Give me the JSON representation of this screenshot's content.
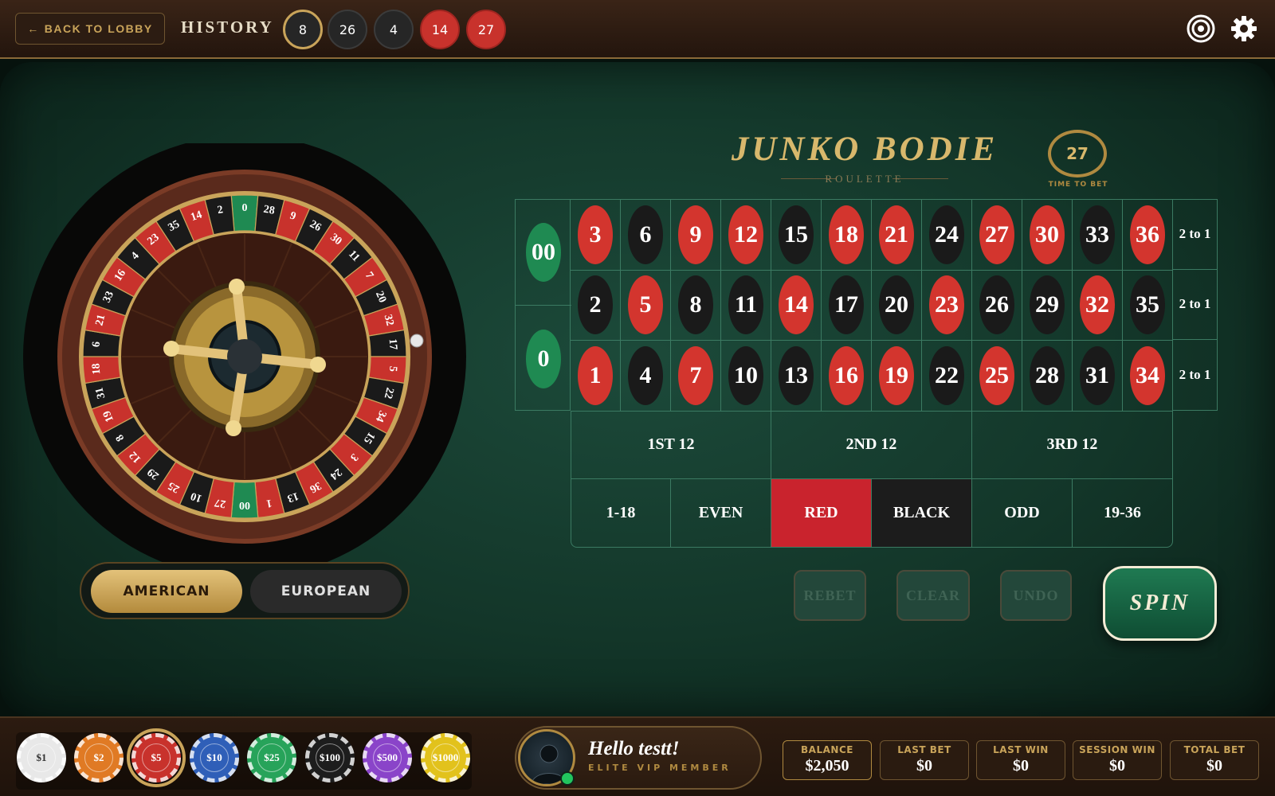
{
  "header": {
    "back_label": "BACK TO LOBBY",
    "history_label": "HISTORY",
    "history": [
      {
        "num": "8",
        "color": "black"
      },
      {
        "num": "26",
        "color": "black"
      },
      {
        "num": "4",
        "color": "black"
      },
      {
        "num": "14",
        "color": "red"
      },
      {
        "num": "27",
        "color": "red"
      }
    ],
    "icons": [
      "target-icon",
      "gear-icon"
    ]
  },
  "game": {
    "title": "JUNKO BODIE",
    "subtitle": "ROULETTE",
    "timer_value": "27",
    "timer_label": "TIME TO BET"
  },
  "wheel": {
    "numbers": [
      "0",
      "28",
      "9",
      "26",
      "30",
      "11",
      "7",
      "20",
      "32",
      "17",
      "5",
      "22",
      "34",
      "15",
      "3",
      "24",
      "36",
      "13",
      "1",
      "00",
      "27",
      "10",
      "25",
      "29",
      "12",
      "8",
      "19",
      "31",
      "18",
      "6",
      "21",
      "33",
      "16",
      "4",
      "23",
      "35",
      "14",
      "2"
    ],
    "red_numbers": [
      "1",
      "3",
      "5",
      "7",
      "9",
      "12",
      "14",
      "16",
      "18",
      "19",
      "21",
      "23",
      "25",
      "27",
      "30",
      "32",
      "34",
      "36"
    ]
  },
  "variant_toggle": {
    "american_label": "AMERICAN",
    "european_label": "EUROPEAN",
    "selected": "AMERICAN"
  },
  "board": {
    "zeros": [
      "00",
      "0"
    ],
    "rows": [
      [
        "3",
        "6",
        "9",
        "12",
        "15",
        "18",
        "21",
        "24",
        "27",
        "30",
        "33",
        "36"
      ],
      [
        "2",
        "5",
        "8",
        "11",
        "14",
        "17",
        "20",
        "23",
        "26",
        "29",
        "32",
        "35"
      ],
      [
        "1",
        "4",
        "7",
        "10",
        "13",
        "16",
        "19",
        "22",
        "25",
        "28",
        "31",
        "34"
      ]
    ],
    "column_bets": [
      "2 to 1",
      "2 to 1",
      "2 to 1"
    ],
    "dozens": [
      "1ST 12",
      "2ND 12",
      "3RD 12"
    ],
    "even_money": [
      "1-18",
      "EVEN",
      "RED",
      "BLACK",
      "ODD",
      "19-36"
    ],
    "colors": {
      "red": "#d3352e",
      "black": "#1a1a1a",
      "green": "#1f8a52",
      "felt": "#133629",
      "gold": "#c9a45a"
    }
  },
  "actions": {
    "rebet": "REBET",
    "clear": "CLEAR",
    "undo": "UNDO",
    "spin": "SPIN"
  },
  "chips": [
    {
      "label": "$1",
      "color": "#e8e8e8"
    },
    {
      "label": "$2",
      "color": "#e07a24"
    },
    {
      "label": "$5",
      "color": "#c8322c"
    },
    {
      "label": "$10",
      "color": "#2f5fb8"
    },
    {
      "label": "$25",
      "color": "#27a35a"
    },
    {
      "label": "$100",
      "color": "#1d1d1d"
    },
    {
      "label": "$500",
      "color": "#8a44c9"
    },
    {
      "label": "$1000",
      "color": "#e2c21c"
    }
  ],
  "selected_chip": "$5",
  "player": {
    "greeting": "Hello testt!",
    "tier": "ELITE VIP MEMBER"
  },
  "stats": [
    {
      "label": "BALANCE",
      "value": "$2,050"
    },
    {
      "label": "LAST BET",
      "value": "$0"
    },
    {
      "label": "LAST WIN",
      "value": "$0"
    },
    {
      "label": "SESSION WIN",
      "value": "$0"
    },
    {
      "label": "TOTAL BET",
      "value": "$0"
    }
  ]
}
